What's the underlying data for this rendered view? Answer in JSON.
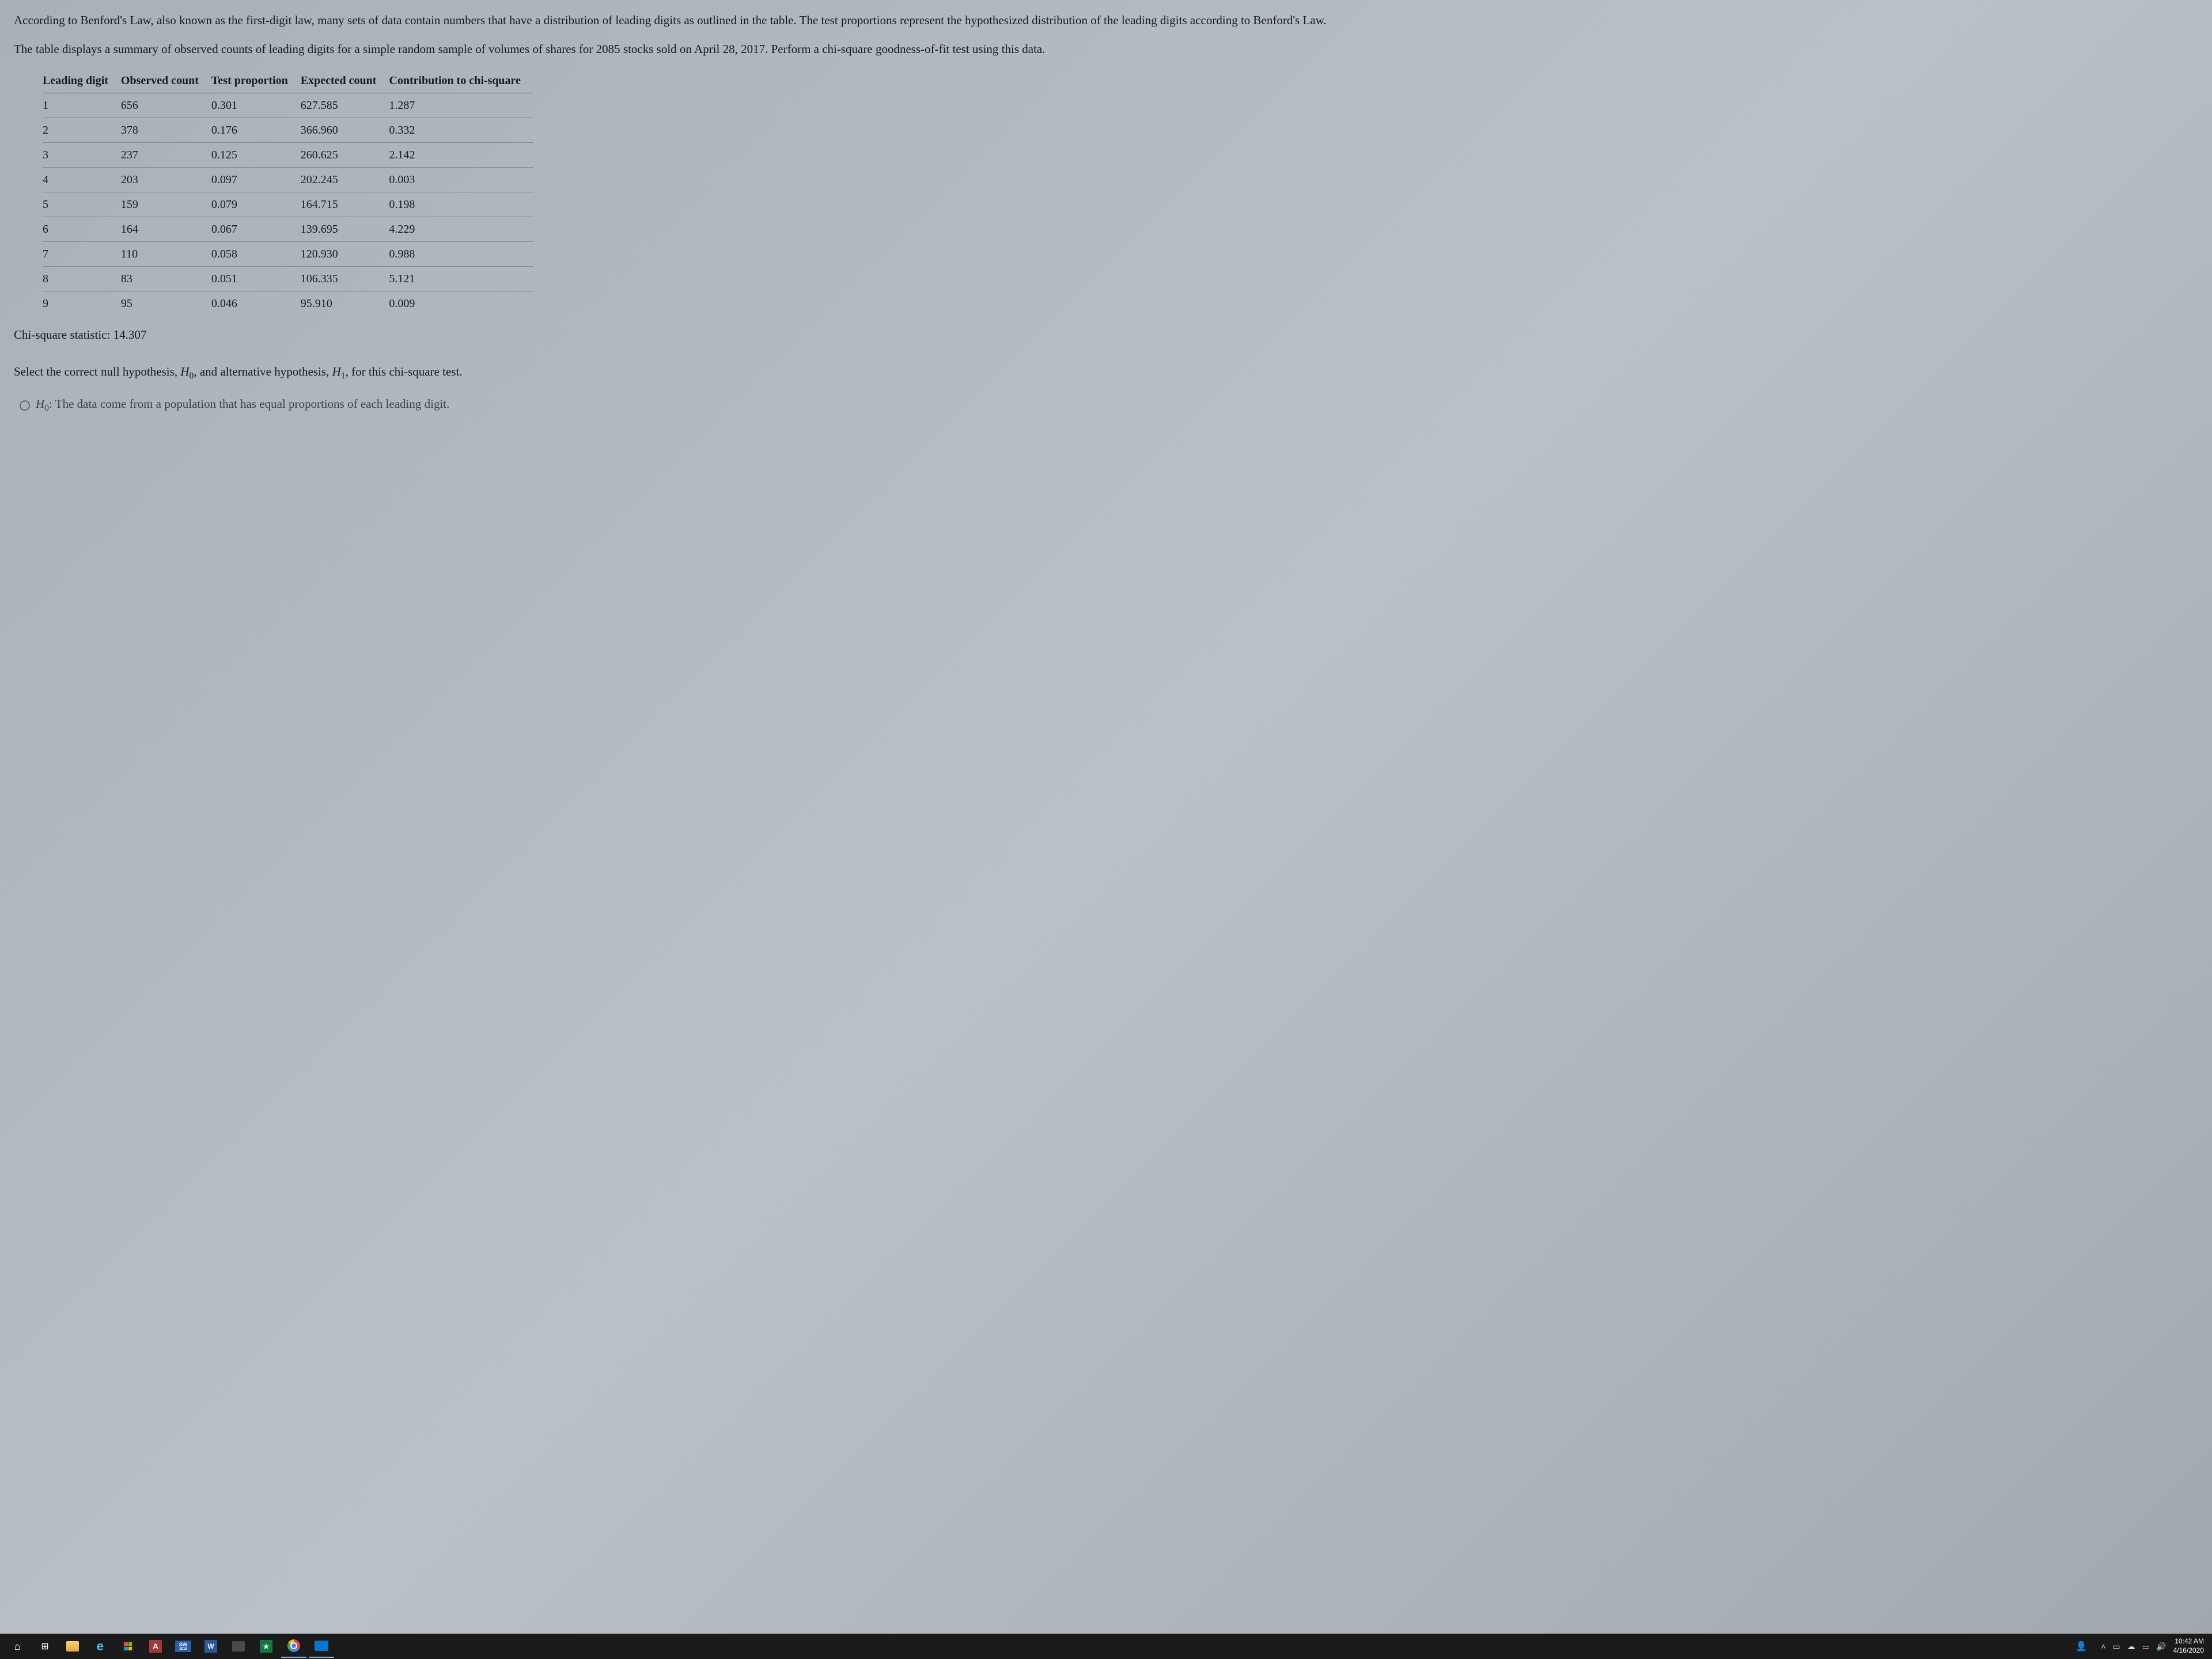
{
  "paragraphs": {
    "p1": "According to Benford's Law, also known as the first-digit law, many sets of data contain numbers that have a distribution of leading digits as outlined in the table. The test proportions represent the hypothesized distribution of the leading digits according to Benford's Law.",
    "p2": "The table displays a summary of observed counts of leading digits for a simple random sample of volumes of shares for 2085 stocks sold on April 28, 2017. Perform a chi-square goodness-of-fit test using this data.",
    "chi_stat": "Chi-square statistic: 14.307",
    "prompt_pre": "Select the correct null hypothesis, ",
    "prompt_h0": "H",
    "prompt_h0_sub": "0",
    "prompt_mid": ", and alternative hypothesis, ",
    "prompt_h1": "H",
    "prompt_h1_sub": "1",
    "prompt_post": ", for this chi-square test.",
    "option_h0_label": "H",
    "option_h0_sub": "0",
    "option_text": ": The data come from a population that has equal proportions of each leading digit."
  },
  "table": {
    "headers": {
      "c1": "Leading digit",
      "c2": "Observed count",
      "c3": "Test proportion",
      "c4": "Expected count",
      "c5": "Contribution to chi-square"
    },
    "rows": [
      {
        "c1": "1",
        "c2": "656",
        "c3": "0.301",
        "c4": "627.585",
        "c5": "1.287"
      },
      {
        "c1": "2",
        "c2": "378",
        "c3": "0.176",
        "c4": "366.960",
        "c5": "0.332"
      },
      {
        "c1": "3",
        "c2": "237",
        "c3": "0.125",
        "c4": "260.625",
        "c5": "2.142"
      },
      {
        "c1": "4",
        "c2": "203",
        "c3": "0.097",
        "c4": "202.245",
        "c5": "0.003"
      },
      {
        "c1": "5",
        "c2": "159",
        "c3": "0.079",
        "c4": "164.715",
        "c5": "0.198"
      },
      {
        "c1": "6",
        "c2": "164",
        "c3": "0.067",
        "c4": "139.695",
        "c5": "4.229"
      },
      {
        "c1": "7",
        "c2": "110",
        "c3": "0.058",
        "c4": "120.930",
        "c5": "0.988"
      },
      {
        "c1": "8",
        "c2": "83",
        "c3": "0.051",
        "c4": "106.335",
        "c5": "5.121"
      },
      {
        "c1": "9",
        "c2": "95",
        "c3": "0.046",
        "c4": "95.910",
        "c5": "0.009"
      }
    ]
  },
  "taskbar": {
    "sw_top": "SW",
    "sw_bottom": "2019",
    "access": "A",
    "word": "W",
    "time": "10:42 AM",
    "date": "4/16/2020"
  }
}
